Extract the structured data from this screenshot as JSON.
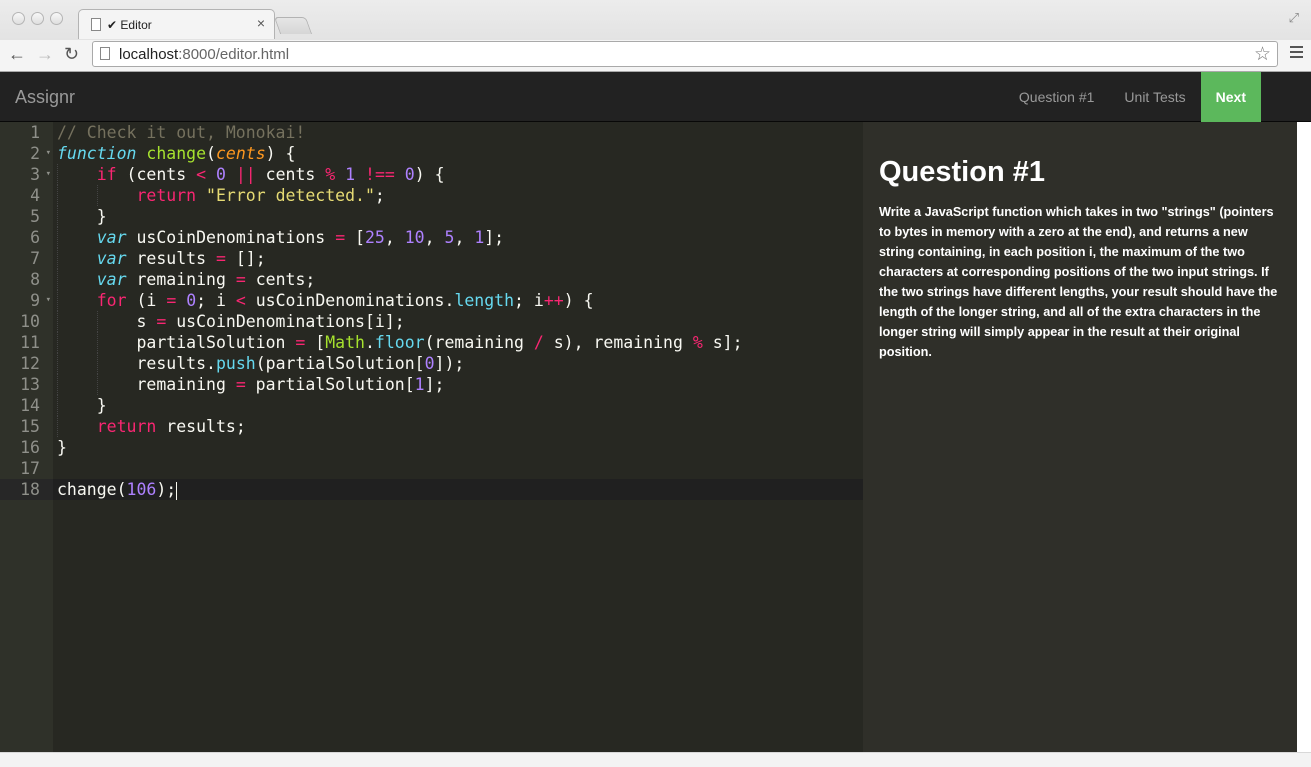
{
  "browser": {
    "tab_title": "✔ Editor",
    "tab_close": "×",
    "url_host": "localhost",
    "url_path": ":8000/editor.html"
  },
  "app": {
    "brand": "Assignr",
    "nav": [
      {
        "label": "Question #1"
      },
      {
        "label": "Unit Tests"
      },
      {
        "label": "Next"
      }
    ]
  },
  "editor": {
    "active_line": 18,
    "lines": [
      "// Check it out, Monokai!",
      "function change(cents) {",
      "    if (cents < 0 || cents % 1 !== 0) {",
      "        return \"Error detected.\";",
      "    }",
      "    var usCoinDenominations = [25, 10, 5, 1];",
      "    var results = [];",
      "    var remaining = cents;",
      "    for (i = 0; i < usCoinDenominations.length; i++) {",
      "        s = usCoinDenominations[i];",
      "        partialSolution = [Math.floor(remaining / s), remaining % s];",
      "        results.push(partialSolution[0]);",
      "        remaining = partialSolution[1];",
      "    }",
      "    return results;",
      "}",
      "",
      "change(106);"
    ]
  },
  "question": {
    "title": "Question #1",
    "body": "Write a JavaScript function which takes in two \"strings\" (pointers to bytes in memory with a zero at the end), and returns a new string containing, in each position i, the maximum of the two characters at corresponding positions of the two input strings. If the two strings have different lengths, your result should have the length of the longer string, and all of the extra characters in the longer string will simply appear in the result at their original position."
  },
  "colors": {
    "editor_bg": "#272822",
    "gutter_bg": "#2f3129",
    "next_button": "#5cb85c",
    "navbar_bg": "#222222",
    "keyword": "#f92672",
    "storage": "#66d9ef",
    "function_name": "#a6e22e",
    "param": "#fd971f",
    "number": "#ae81ff",
    "string": "#e6db74",
    "comment": "#75715e"
  }
}
